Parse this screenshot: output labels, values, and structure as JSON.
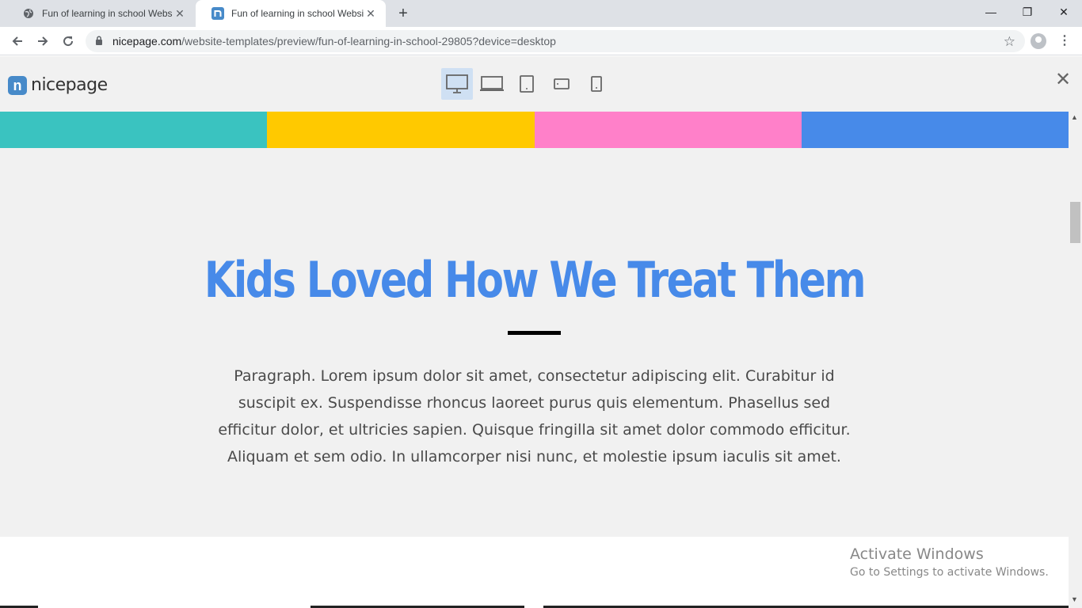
{
  "browser": {
    "tabs": [
      {
        "title": "Fun of learning in school Website",
        "active": false,
        "favicon": "globe-icon"
      },
      {
        "title": "Fun of learning in school Website",
        "active": true,
        "favicon": "nicepage-icon"
      }
    ],
    "new_tab": "+",
    "url_domain": "nicepage.com",
    "url_path": "/website-templates/preview/fun-of-learning-in-school-29805?device=desktop",
    "window_controls": {
      "minimize": "—",
      "restore": "❐",
      "close": "✕"
    }
  },
  "preview_header": {
    "logo_mark": "n",
    "logo_text": "nicepage",
    "devices": [
      "desktop",
      "laptop",
      "tablet",
      "phone-landscape",
      "phone"
    ],
    "active_device": "desktop",
    "close": "✕"
  },
  "page": {
    "stripe_colors": [
      "#3ac3c0",
      "#ffc900",
      "#ff80c9",
      "#478ae9"
    ],
    "heading": "Kids Loved How We Treat Them",
    "heading_color": "#478ae9",
    "paragraph": "Paragraph. Lorem ipsum dolor sit amet, consectetur adipiscing elit. Curabitur id suscipit ex. Suspendisse rhoncus laoreet purus quis elementum. Phasellus sed efficitur dolor, et ultricies sapien. Quisque fringilla sit amet dolor commodo efficitur. Aliquam et sem odio. In ullamcorper nisi nunc, et molestie ipsum iaculis sit amet."
  },
  "watermark": {
    "title": "Activate Windows",
    "subtitle": "Go to Settings to activate Windows."
  }
}
